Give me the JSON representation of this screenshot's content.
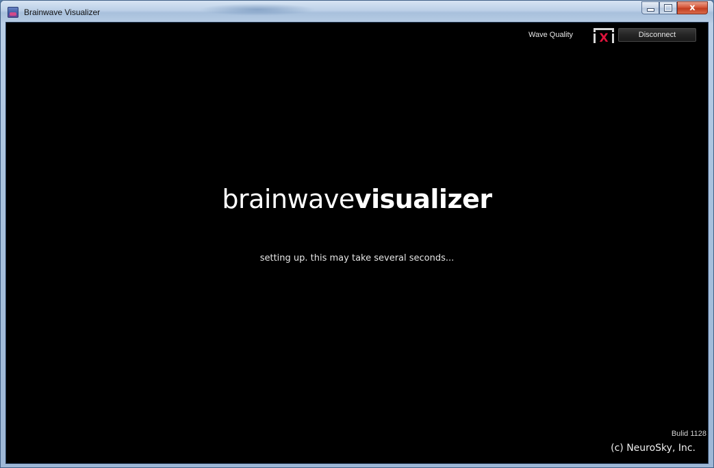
{
  "window": {
    "title": "Brainwave Visualizer",
    "controls": {
      "minimize": "–",
      "close": "x"
    }
  },
  "header": {
    "wave_quality_label": "Wave Quality",
    "wave_quality_icon": "no-signal-x-icon",
    "wave_quality_mark": "X",
    "disconnect_label": "Disconnect"
  },
  "main": {
    "logo_light": "brainwave",
    "logo_bold": "visualizer",
    "status": "setting up. this may take several seconds..."
  },
  "footer": {
    "build": "Bulid 1128",
    "copyright": "(c) NeuroSky, Inc."
  },
  "colors": {
    "background": "#000000",
    "quality_x": "#e0143c",
    "text": "#ffffff"
  }
}
